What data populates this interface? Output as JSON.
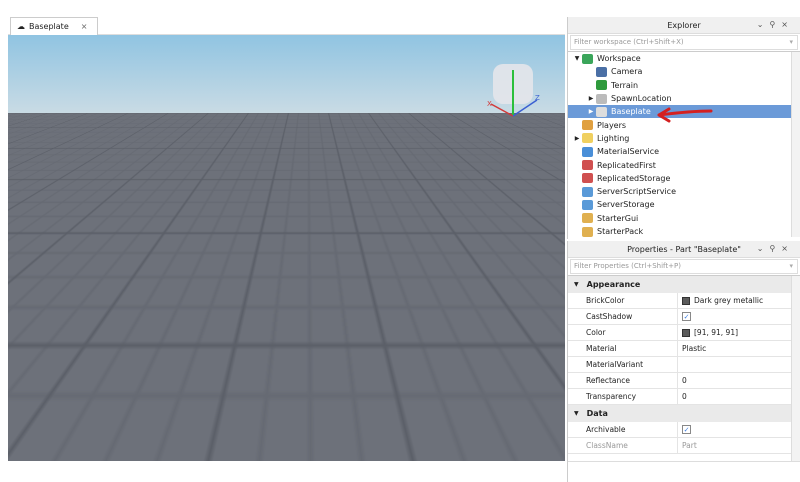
{
  "tab": {
    "label": "Baseplate",
    "close": "×"
  },
  "explorer": {
    "title": "Explorer",
    "filter_placeholder": "Filter workspace (Ctrl+Shift+X)",
    "items": [
      {
        "label": "Workspace",
        "depth": 0,
        "arrow": "▼",
        "color": "#3aa55a"
      },
      {
        "label": "Camera",
        "depth": 1,
        "arrow": "",
        "color": "#4a6fa5"
      },
      {
        "label": "Terrain",
        "depth": 1,
        "arrow": "",
        "color": "#2e9a3c"
      },
      {
        "label": "SpawnLocation",
        "depth": 1,
        "arrow": "▶",
        "color": "#bbbbbb"
      },
      {
        "label": "Baseplate",
        "depth": 1,
        "arrow": "▶",
        "color": "#dddddd",
        "selected": true
      },
      {
        "label": "Players",
        "depth": 0,
        "arrow": "",
        "color": "#e0a040"
      },
      {
        "label": "Lighting",
        "depth": 0,
        "arrow": "▶",
        "color": "#f0d060"
      },
      {
        "label": "MaterialService",
        "depth": 0,
        "arrow": "",
        "color": "#4a8fd8"
      },
      {
        "label": "ReplicatedFirst",
        "depth": 0,
        "arrow": "",
        "color": "#d05050"
      },
      {
        "label": "ReplicatedStorage",
        "depth": 0,
        "arrow": "",
        "color": "#d05050"
      },
      {
        "label": "ServerScriptService",
        "depth": 0,
        "arrow": "",
        "color": "#5a9ad8"
      },
      {
        "label": "ServerStorage",
        "depth": 0,
        "arrow": "",
        "color": "#5a9ad8"
      },
      {
        "label": "StarterGui",
        "depth": 0,
        "arrow": "",
        "color": "#e0b050"
      },
      {
        "label": "StarterPack",
        "depth": 0,
        "arrow": "",
        "color": "#e0b050"
      }
    ]
  },
  "properties": {
    "title": "Properties - Part \"Baseplate\"",
    "filter_placeholder": "Filter Properties (Ctrl+Shift+P)",
    "categories": [
      {
        "name": "Appearance",
        "rows": [
          {
            "key": "BrickColor",
            "value": "Dark grey metallic",
            "swatch": "#5b5b5b"
          },
          {
            "key": "CastShadow",
            "checkbox": true
          },
          {
            "key": "Color",
            "value": "[91, 91, 91]",
            "swatch": "#5b5b5b"
          },
          {
            "key": "Material",
            "value": "Plastic"
          },
          {
            "key": "MaterialVariant",
            "value": ""
          },
          {
            "key": "Reflectance",
            "value": "0"
          },
          {
            "key": "Transparency",
            "value": "0"
          }
        ]
      },
      {
        "name": "Data",
        "rows": [
          {
            "key": "Archivable",
            "checkbox": true
          },
          {
            "key": "ClassName",
            "value": "Part",
            "muted": true
          }
        ]
      }
    ]
  },
  "viewcube": {
    "x": "X",
    "z": "Z"
  }
}
